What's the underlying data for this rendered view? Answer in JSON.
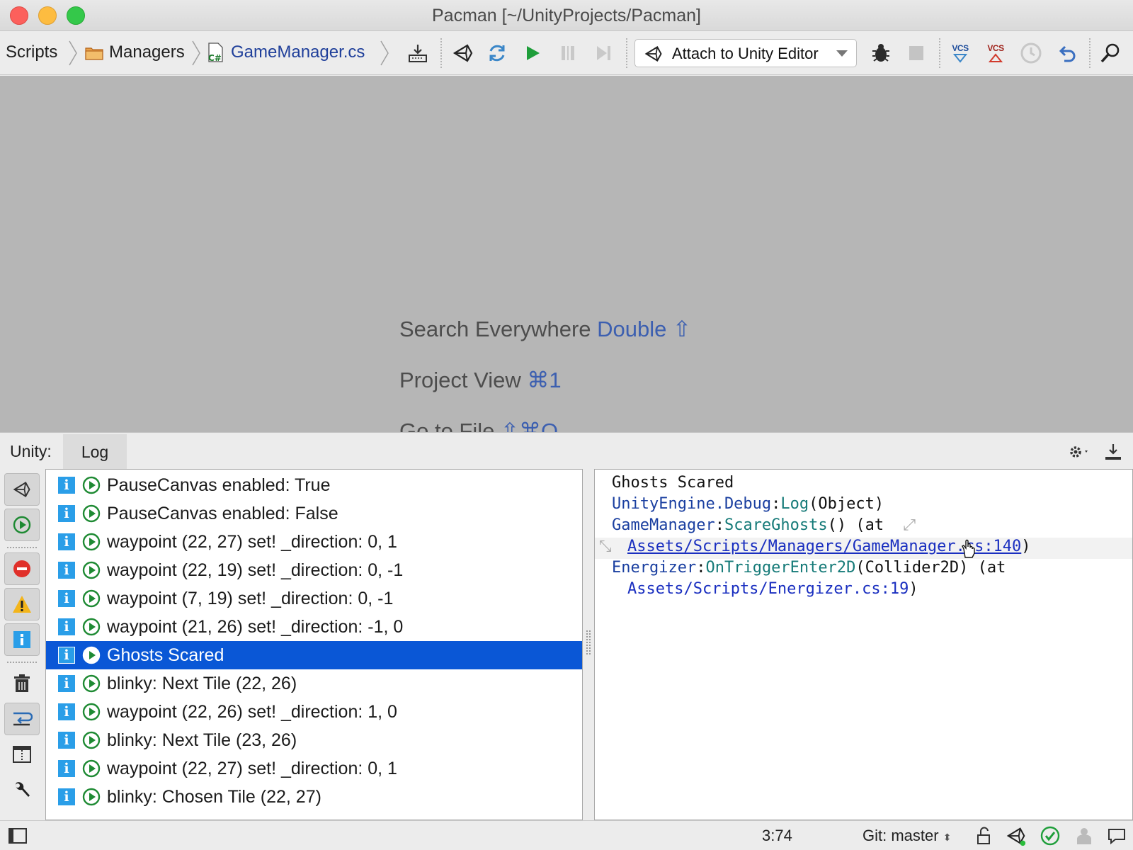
{
  "window": {
    "title": "Pacman [~/UnityProjects/Pacman]"
  },
  "breadcrumb": {
    "items": [
      "Scripts",
      "Managers",
      "GameManager.cs"
    ]
  },
  "toolbar": {
    "run_config_label": "Attach to Unity Editor",
    "vcs_update_label": "VCS",
    "vcs_commit_label": "VCS"
  },
  "editor": {
    "hints": [
      {
        "label": "Search Everywhere",
        "key": "Double ⇧"
      },
      {
        "label": "Project View",
        "key": "⌘1"
      },
      {
        "label": "Go to File",
        "key": "⇧⌘O"
      }
    ]
  },
  "tool_window": {
    "label": "Unity:",
    "tab": "Log"
  },
  "log": {
    "entries": [
      "PauseCanvas enabled: True",
      "PauseCanvas enabled: False",
      "waypoint (22, 27) set! _direction: 0, 1",
      "waypoint (22, 19) set! _direction: 0, -1",
      "waypoint (7, 19) set! _direction: 0, -1",
      "waypoint (21, 26) set! _direction: -1, 0",
      "Ghosts Scared",
      "blinky: Next Tile (22, 26)",
      "waypoint (22, 26) set! _direction: 1, 0",
      "blinky: Next Tile (23, 26)",
      "waypoint (22, 27) set! _direction: 0, 1",
      "blinky: Chosen Tile (22, 27)"
    ],
    "selected_index": 6
  },
  "detail": {
    "message": "Ghosts Scared",
    "trace": {
      "l1_ns": "UnityEngine.Debug",
      "l1_sep": ":",
      "l1_method": "Log",
      "l1_args": "(Object)",
      "l2_ns": "GameManager",
      "l2_sep": ":",
      "l2_method": "ScareGhosts",
      "l2_args": "() (at",
      "l3_link": "Assets/Scripts/Managers/GameManager.cs:140",
      "l3_close": ")",
      "l4_ns": "Energizer",
      "l4_sep": ":",
      "l4_method": "OnTriggerEnter2D",
      "l4_args": "(Collider2D) (at",
      "l5_link": "Assets/Scripts/Energizer.cs:19",
      "l5_close": ")"
    }
  },
  "status": {
    "position": "3:74",
    "git_branch": "Git: master"
  },
  "colors": {
    "selection": "#0a57d6",
    "info_badge": "#2a9ee8",
    "run_green": "#1e9e3a",
    "link_blue": "#1a2fc0"
  }
}
